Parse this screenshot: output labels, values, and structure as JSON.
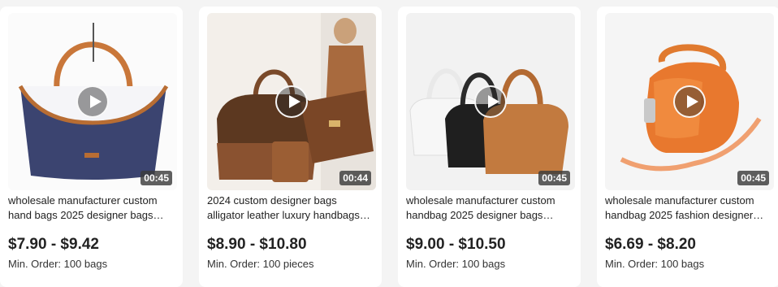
{
  "products": [
    {
      "title": "wholesale manufacturer custom hand bags 2025 designer bags handbags for women",
      "price": "$7.90 - $9.42",
      "min_order": "Min. Order: 100 bags",
      "duration": "00:45"
    },
    {
      "title": "2024 custom designer bags alligator leather luxury handbags for women",
      "price": "$8.90 - $10.80",
      "min_order": "Min. Order: 100 pieces",
      "duration": "00:44"
    },
    {
      "title": "wholesale manufacturer custom handbag 2025 designer bags handbags for women",
      "price": "$9.00 - $10.50",
      "min_order": "Min. Order: 100 bags",
      "duration": "00:45"
    },
    {
      "title": "wholesale manufacturer custom handbag 2025 fashion designer bags for women",
      "price": "$6.69 - $8.20",
      "min_order": "Min. Order: 100 bags",
      "duration": "00:45"
    }
  ]
}
